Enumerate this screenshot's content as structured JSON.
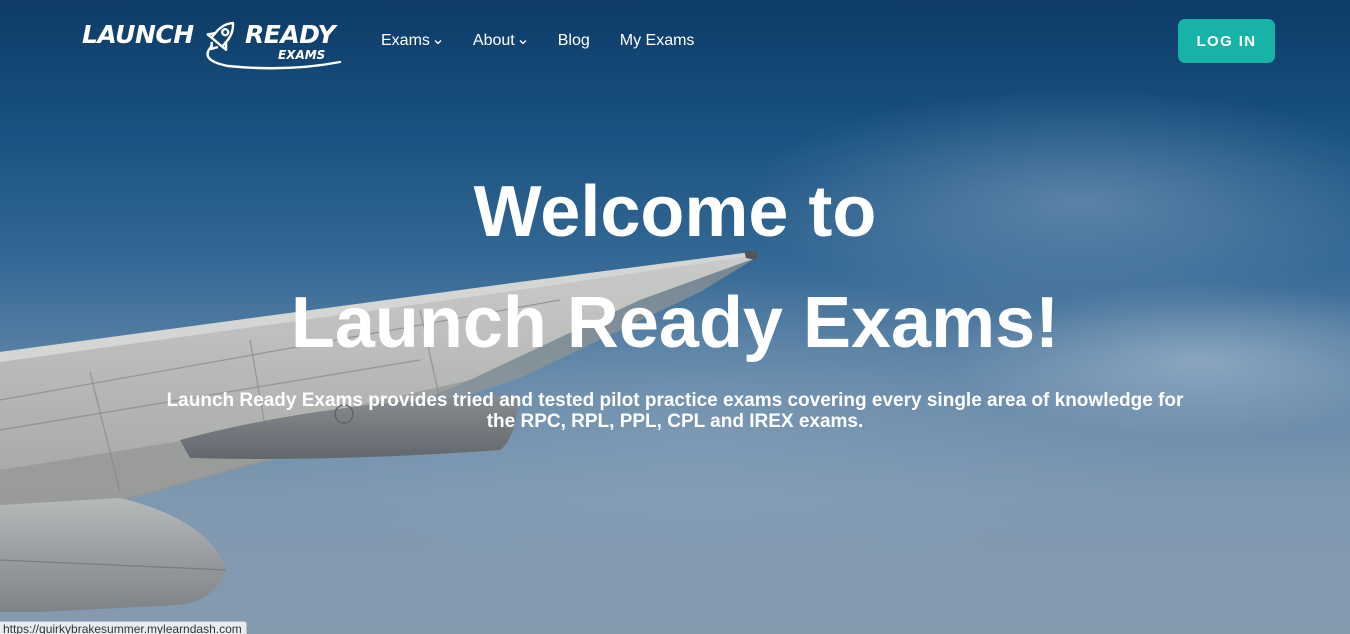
{
  "header": {
    "logo": {
      "word_left": "LAUNCH",
      "word_right": "READY",
      "subtitle": "EXAMS",
      "alt": "Launch Ready Exams"
    },
    "nav": [
      {
        "label": "Exams",
        "has_dropdown": true
      },
      {
        "label": "About",
        "has_dropdown": true
      },
      {
        "label": "Blog",
        "has_dropdown": false
      },
      {
        "label": "My Exams",
        "has_dropdown": false
      }
    ],
    "login_label": "LOG IN"
  },
  "hero": {
    "title_line1": "Welcome to",
    "title_line2": "Launch Ready Exams!",
    "description": "Launch Ready Exams provides tried and tested pilot practice exams covering every single area of knowledge for the RPC, RPL, PPL, CPL and IREX exams.",
    "background": "sky-with-airplane-wing"
  },
  "status_bar": {
    "url": "https://quirkybrakesummer.mylearndash.com"
  },
  "colors": {
    "accent": "#17b3a8",
    "text": "#ffffff",
    "sky_top": "#0f3f6e",
    "sky_bottom": "#98abbf"
  }
}
